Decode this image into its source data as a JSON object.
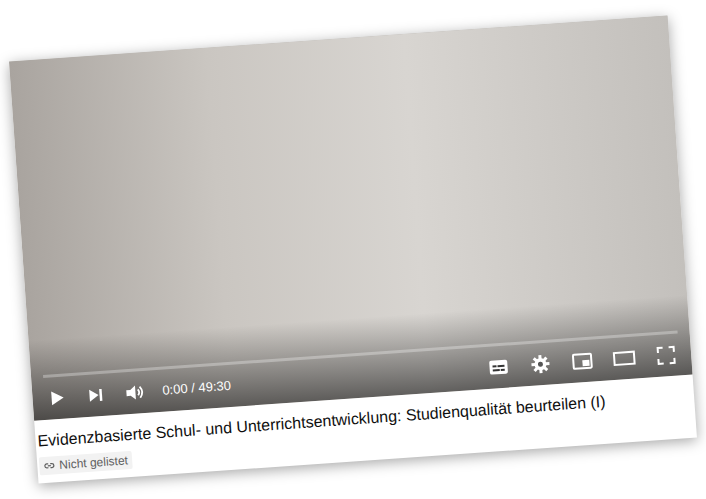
{
  "player": {
    "time": "0:00 / 49:30",
    "level": 0,
    "playing": false
  },
  "video": {
    "title": "Evidenzbasierte Schul- und Unterrichtsentwicklung: Studienqualität beurteilen (I)",
    "visibility": "Nicht gelistet"
  }
}
